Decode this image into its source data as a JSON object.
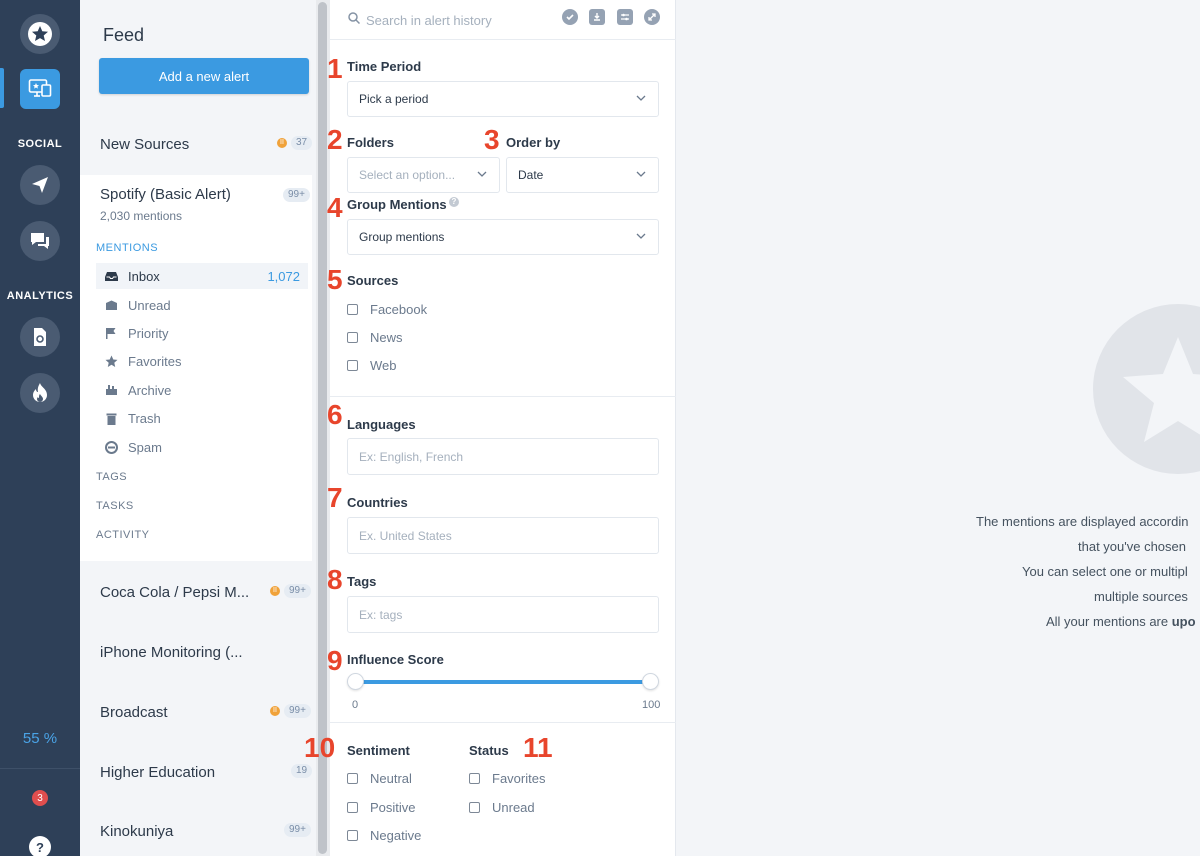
{
  "rail": {
    "section_social": "SOCIAL",
    "section_analytics": "ANALYTICS",
    "percent": "55 %",
    "notifications_count": "3",
    "help_label": "?"
  },
  "feed": {
    "title": "Feed",
    "add_alert_label": "Add a new alert",
    "alerts": [
      {
        "name": "New Sources",
        "count": "37"
      },
      {
        "name": "Spotify (Basic Alert)",
        "count": "99+",
        "mentions": "2,030 mentions"
      },
      {
        "name": "Coca Cola / Pepsi M...",
        "count": "99+"
      },
      {
        "name": "iPhone Monitoring (..."
      },
      {
        "name": "Broadcast",
        "count": "99+"
      },
      {
        "name": "Higher Education",
        "count": "19"
      },
      {
        "name": "Kinokuniya",
        "count": "99+"
      }
    ],
    "mentions_label": "MENTIONS",
    "items": [
      {
        "label": "Inbox",
        "count": "1,072"
      },
      {
        "label": "Unread"
      },
      {
        "label": "Priority"
      },
      {
        "label": "Favorites"
      },
      {
        "label": "Archive"
      },
      {
        "label": "Trash"
      },
      {
        "label": "Spam"
      }
    ],
    "tags_label": "TAGS",
    "tasks_label": "TASKS",
    "activity_label": "ACTIVITY"
  },
  "filters": {
    "search_placeholder": "Search in alert history",
    "numbers": [
      "1",
      "2",
      "3",
      "4",
      "5",
      "6",
      "7",
      "8",
      "9",
      "10",
      "11"
    ],
    "time_period": {
      "label": "Time Period",
      "value": "Pick a period"
    },
    "folders": {
      "label": "Folders",
      "placeholder": "Select an option..."
    },
    "order_by": {
      "label": "Order by",
      "value": "Date"
    },
    "group_mentions": {
      "label": "Group Mentions",
      "value": "Group mentions"
    },
    "sources": {
      "label": "Sources",
      "options": [
        "Facebook",
        "News",
        "Web"
      ]
    },
    "languages": {
      "label": "Languages",
      "placeholder": "Ex: English, French"
    },
    "countries": {
      "label": "Countries",
      "placeholder": "Ex. United States"
    },
    "tags": {
      "label": "Tags",
      "placeholder": "Ex: tags"
    },
    "influence": {
      "label": "Influence Score",
      "min": "0",
      "max": "100"
    },
    "sentiment": {
      "label": "Sentiment",
      "options": [
        "Neutral",
        "Positive",
        "Negative"
      ]
    },
    "status": {
      "label": "Status",
      "options": [
        "Favorites",
        "Unread"
      ]
    }
  },
  "empty_state": {
    "line1": "The mentions are displayed accordin",
    "line2": "that you've chosen",
    "line3": "You can select one or multipl",
    "line4": "multiple sources",
    "line5_prefix": "All your mentions are ",
    "line5_bold": "upo"
  },
  "colors": {
    "rail_bg": "#2e4058",
    "accent": "#3b9ae1",
    "annotation_red": "#e8452c",
    "badge_orange": "#f0a23a"
  }
}
